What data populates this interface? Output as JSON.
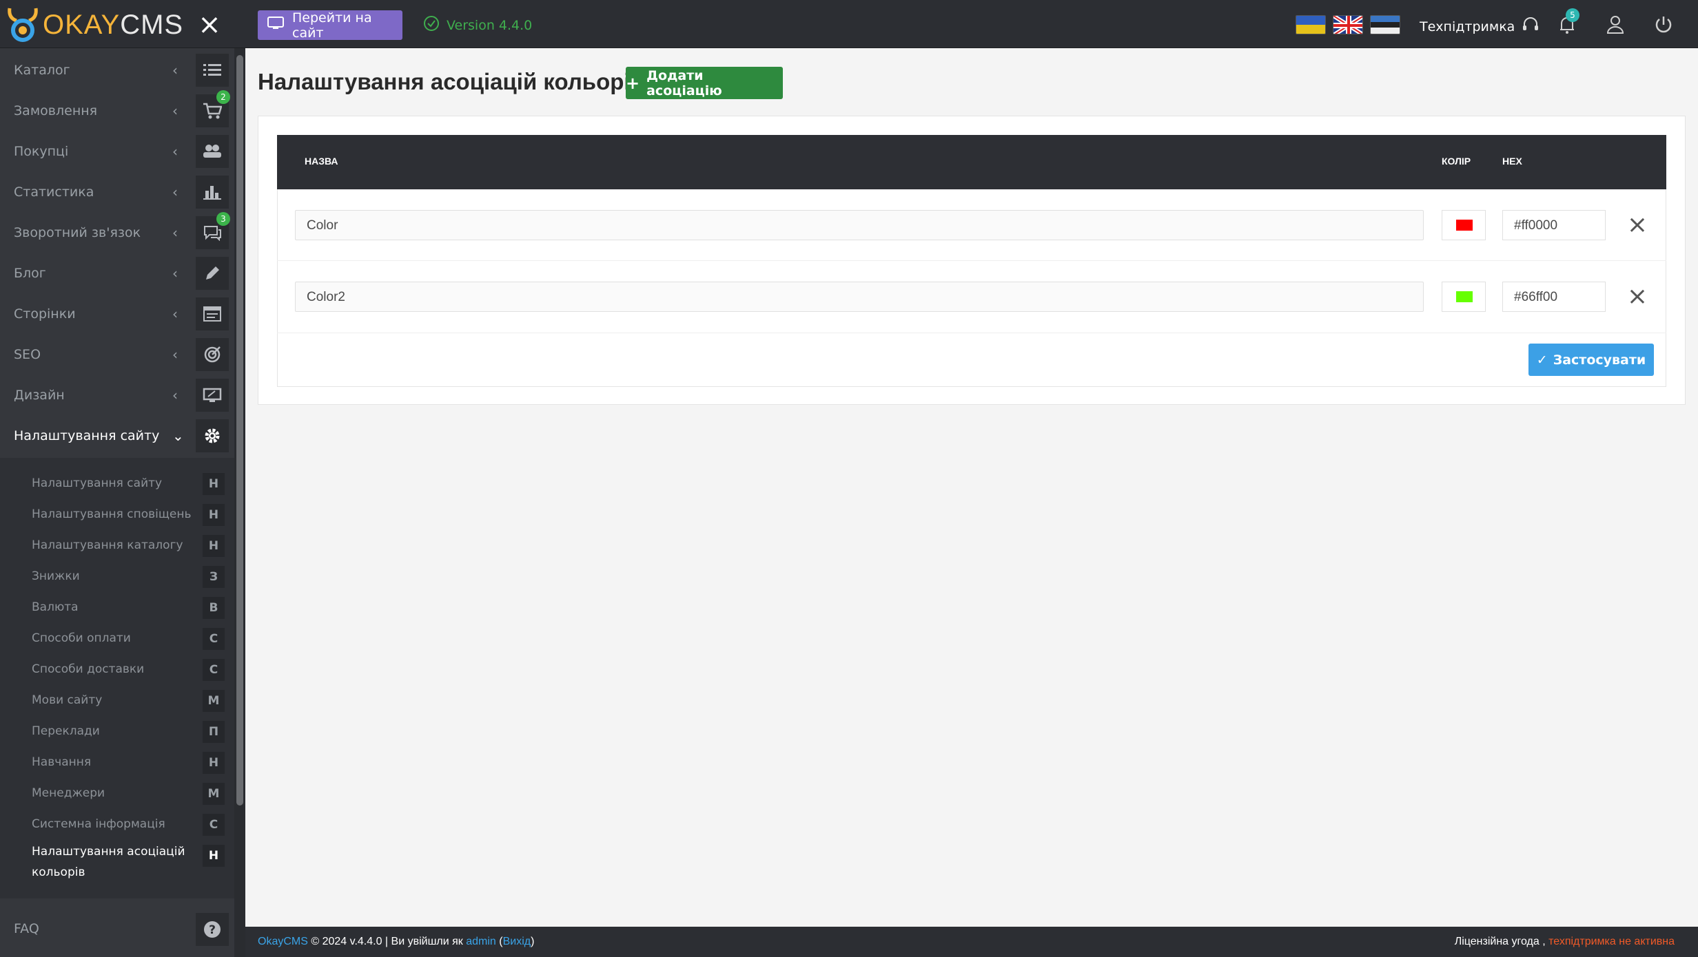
{
  "brand": {
    "logo_okay": "OKAY",
    "logo_cms": "CMS"
  },
  "topbar": {
    "goto_site_label": "Перейти на сайт",
    "version_label": "Version 4.4.0",
    "support_label": "Техпідтримка",
    "notifications_count": "5"
  },
  "sidebar": {
    "items": [
      {
        "label": "Каталог",
        "icon": "list-icon"
      },
      {
        "label": "Замовлення",
        "icon": "cart-icon",
        "badge": "2"
      },
      {
        "label": "Покупці",
        "icon": "users-icon"
      },
      {
        "label": "Статистика",
        "icon": "bar-chart-icon"
      },
      {
        "label": "Зворотний зв'язок",
        "icon": "chat-icon",
        "badge": "3"
      },
      {
        "label": "Блог",
        "icon": "pencil-icon"
      },
      {
        "label": "Сторінки",
        "icon": "pages-icon"
      },
      {
        "label": "SEO",
        "icon": "target-icon"
      },
      {
        "label": "Дизайн",
        "icon": "monitor-icon"
      },
      {
        "label": "Налаштування сайту",
        "icon": "gear-icon"
      }
    ],
    "submenu": [
      {
        "label": "Налаштування сайту",
        "letter": "Н"
      },
      {
        "label": "Налаштування сповіщень",
        "letter": "Н"
      },
      {
        "label": "Налаштування каталогу",
        "letter": "Н"
      },
      {
        "label": "Знижки",
        "letter": "З"
      },
      {
        "label": "Валюта",
        "letter": "В"
      },
      {
        "label": "Способи оплати",
        "letter": "С"
      },
      {
        "label": "Способи доставки",
        "letter": "С"
      },
      {
        "label": "Мови сайту",
        "letter": "М"
      },
      {
        "label": "Переклади",
        "letter": "П"
      },
      {
        "label": "Навчання",
        "letter": "Н"
      },
      {
        "label": "Менеджери",
        "letter": "М"
      },
      {
        "label": "Системна інформація",
        "letter": "С"
      },
      {
        "label_line1": "Налаштування асоціацій",
        "label_line2": "кольорів",
        "letter": "Н"
      }
    ],
    "faq_label": "FAQ"
  },
  "main": {
    "title": "Налаштування асоціацій кольорів",
    "add_button": "Додати асоціацію",
    "table": {
      "headers": {
        "name": "НАЗВА",
        "color": "КОЛІР",
        "hex": "HEX"
      },
      "rows": [
        {
          "name": "Color",
          "hex": "#ff0000",
          "swatch": "#ff0000"
        },
        {
          "name": "Color2",
          "hex": "#66ff00",
          "swatch": "#66ff00"
        }
      ]
    },
    "apply_button": "Застосувати"
  },
  "footer": {
    "brand_link": "OkayCMS",
    "copyright": "© 2024 v.4.4.0 | Ви увійшли як",
    "user_link": "admin",
    "logout_link": "Вихід",
    "paren_open": "(",
    "paren_close": ")",
    "license_label": "Ліцензійна угода ,",
    "support_status": "техпідтримка не активна"
  },
  "colors": {
    "accent_purple": "#7e69c7",
    "accent_green": "#2e8a3e",
    "accent_blue": "#3ca0e6",
    "warning": "#f05a28"
  }
}
